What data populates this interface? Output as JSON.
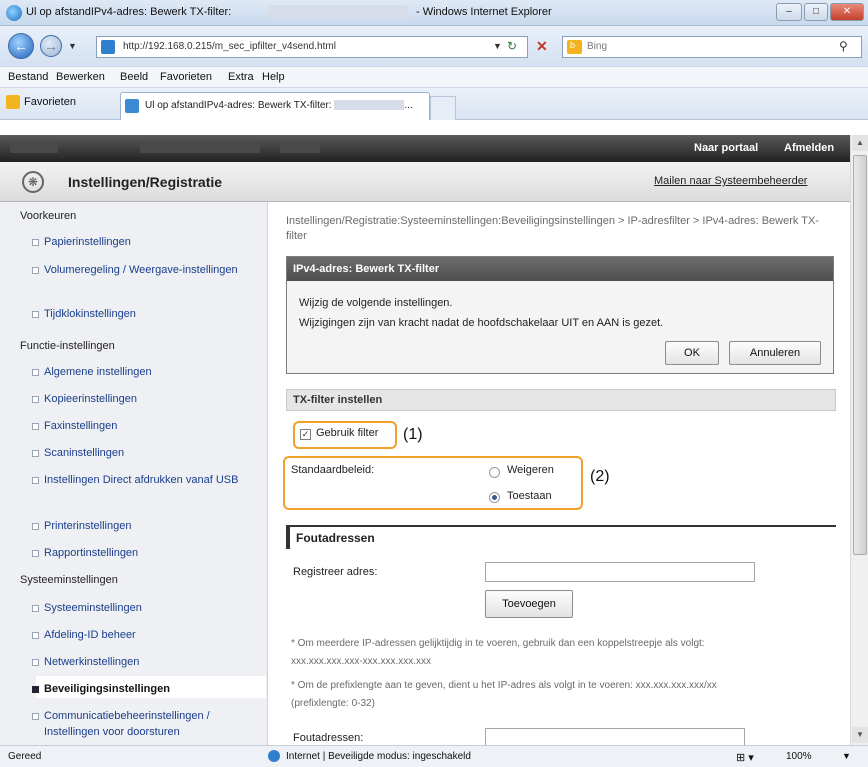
{
  "window": {
    "title": "Ul op afstandIPv4-adres: Bewerk TX-filter:",
    "title_suffix": "- Windows Internet Explorer"
  },
  "address": {
    "url": "http://192.168.0.215/m_sec_ipfilter_v4send.html",
    "search_placeholder": "Bing",
    "search_icon_label": "b"
  },
  "menu": [
    "Bestand",
    "Bewerken",
    "Beeld",
    "Favorieten",
    "Extra",
    "Help"
  ],
  "favorites": {
    "label": "Favorieten",
    "tab_title": "Ul op afstandIPv4-adres: Bewerk TX-filter:"
  },
  "topbar": {
    "portal": "Naar portaal",
    "logout": "Afmelden"
  },
  "header": {
    "title": "Instellingen/Registratie",
    "mail_link": "Mailen naar Systeembeheerder"
  },
  "sidebar": {
    "voorkeuren": "Voorkeuren",
    "pref_items": [
      "Papierinstellingen",
      "Volumeregeling / Weergave-instellingen",
      "Tijdklokinstellingen"
    ],
    "functie": "Functie-instellingen",
    "functie_items": [
      "Algemene instellingen",
      "Kopieerinstellingen",
      "Faxinstellingen",
      "Scaninstellingen",
      "Instellingen Direct afdrukken vanaf USB",
      "Printerinstellingen",
      "Rapportinstellingen"
    ],
    "systeem": "Systeeminstellingen",
    "systeem_items": [
      "Systeeminstellingen",
      "Afdeling-ID beheer",
      "Netwerkinstellingen",
      "Beveiligingsinstellingen",
      "Communicatiebeheerinstellingen / Instellingen voor doorsturen"
    ]
  },
  "main": {
    "breadcrumb": "Instellingen/Registratie:Systeeminstellingen:Beveiligingsinstellingen > IP-adresfilter > IPv4-adres: Bewerk TX-filter",
    "dialog_title": "IPv4-adres: Bewerk TX-filter",
    "dialog_msg1": "Wijzig de volgende instellingen.",
    "dialog_msg2": "Wijzigingen zijn van kracht nadat de hoofdschakelaar UIT en AAN is gezet.",
    "ok": "OK",
    "cancel": "Annuleren",
    "tx_section": "TX-filter instellen",
    "use_filter": "Gebruik filter",
    "use_filter_checked": true,
    "ann1": "(1)",
    "default_policy": "Standaardbeleid:",
    "refuse": "Weigeren",
    "allow": "Toestaan",
    "selected_policy": "Toestaan",
    "ann2": "(2)",
    "fout_section": "Foutadressen",
    "register_label": "Registreer adres:",
    "register_value": "",
    "add_button": "Toevoegen",
    "note1a": "* Om meerdere IP-adressen gelijktijdig in te voeren, gebruik dan een koppelstreepje als volgt:",
    "note1b": "xxx.xxx.xxx.xxx-xxx.xxx.xxx.xxx",
    "note2a": "* Om de prefixlengte aan te geven, dient u het IP-adres als volgt in te voeren: xxx.xxx.xxx.xxx/xx",
    "note2b": "(prefixlengte: 0-32)",
    "fout_label": "Foutadressen:"
  },
  "status": {
    "left": "Gereed",
    "zone": "Internet | Beveiligde modus: ingeschakeld",
    "zoom": "100%"
  }
}
